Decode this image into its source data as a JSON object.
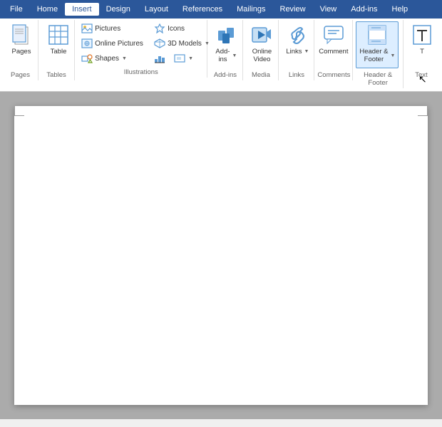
{
  "menu": {
    "items": [
      {
        "id": "file",
        "label": "File"
      },
      {
        "id": "home",
        "label": "Home"
      },
      {
        "id": "insert",
        "label": "Insert",
        "active": true
      },
      {
        "id": "design",
        "label": "Design"
      },
      {
        "id": "layout",
        "label": "Layout"
      },
      {
        "id": "references",
        "label": "References"
      },
      {
        "id": "mailings",
        "label": "Mailings"
      },
      {
        "id": "review",
        "label": "Review"
      },
      {
        "id": "view",
        "label": "View"
      },
      {
        "id": "addins",
        "label": "Add-ins"
      },
      {
        "id": "help",
        "label": "Help"
      }
    ]
  },
  "ribbon": {
    "groups": [
      {
        "id": "pages",
        "label": "Pages",
        "buttons": [
          {
            "id": "pages-btn",
            "label": "Pages",
            "icon": "pages-icon"
          }
        ]
      },
      {
        "id": "tables",
        "label": "Tables",
        "buttons": [
          {
            "id": "table-btn",
            "label": "Table",
            "icon": "table-icon"
          }
        ]
      },
      {
        "id": "illustrations",
        "label": "Illustrations",
        "small_buttons": [
          {
            "id": "pictures-btn",
            "label": "Pictures",
            "icon": "pictures-icon"
          },
          {
            "id": "online-pictures-btn",
            "label": "Online Pictures",
            "icon": "online-pictures-icon"
          },
          {
            "id": "shapes-btn",
            "label": "Shapes",
            "icon": "shapes-icon",
            "has_arrow": true
          }
        ],
        "small_buttons2": [
          {
            "id": "icons-btn",
            "label": "Icons",
            "icon": "icons-icon"
          },
          {
            "id": "3d-models-btn",
            "label": "3D Models",
            "icon": "3d-icon",
            "has_arrow": true
          },
          {
            "id": "chart-btn",
            "label": "",
            "icon": "chart-icon"
          },
          {
            "id": "screenshot-btn",
            "label": "",
            "icon": "screenshot-icon",
            "has_arrow": true
          }
        ]
      },
      {
        "id": "addins-group",
        "label": "Add-ins",
        "buttons": [
          {
            "id": "addins-btn",
            "label": "Add-\nins",
            "icon": "addins-icon",
            "has_arrow": true
          }
        ]
      },
      {
        "id": "media",
        "label": "Media",
        "buttons": [
          {
            "id": "online-video-btn",
            "label": "Online\nVideo",
            "icon": "video-icon"
          }
        ]
      },
      {
        "id": "links",
        "label": "Links",
        "buttons": [
          {
            "id": "links-btn",
            "label": "Links",
            "icon": "links-icon",
            "has_arrow": true
          }
        ]
      },
      {
        "id": "comments",
        "label": "Comments",
        "buttons": [
          {
            "id": "comment-btn",
            "label": "Comment",
            "icon": "comment-icon"
          }
        ]
      },
      {
        "id": "header-footer",
        "label": "Header & Footer",
        "buttons": [
          {
            "id": "header-footer-btn",
            "label": "Header &\nFooter",
            "icon": "header-footer-icon",
            "has_arrow": true,
            "highlighted": true
          }
        ]
      },
      {
        "id": "text-group",
        "label": "Text",
        "buttons": [
          {
            "id": "text-btn",
            "label": "T",
            "icon": "text-icon"
          }
        ]
      }
    ]
  },
  "document": {
    "background_color": "#ababab",
    "page_color": "#ffffff"
  },
  "cursor": {
    "visible": true
  }
}
